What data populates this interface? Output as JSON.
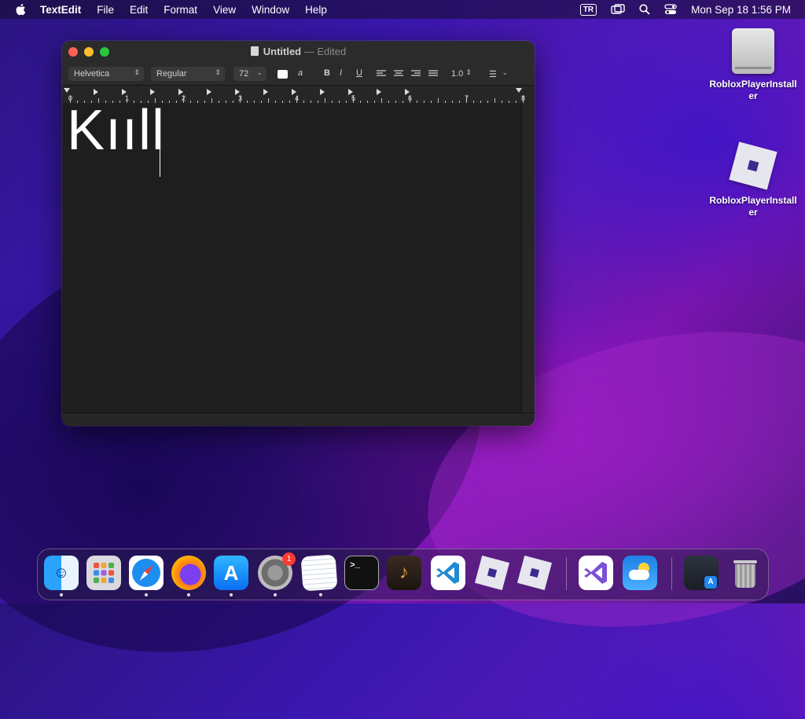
{
  "menubar": {
    "app_name": "TextEdit",
    "items": [
      "File",
      "Edit",
      "Format",
      "View",
      "Window",
      "Help"
    ],
    "input_source": "TR",
    "clock": "Mon Sep 18  1:56 PM"
  },
  "window": {
    "title": "Untitled",
    "separator": "—",
    "status": "Edited",
    "toolbar": {
      "font_family": "Helvetica",
      "font_style": "Regular",
      "font_size": "72",
      "bold": "B",
      "italic": "I",
      "underline": "U",
      "line_spacing": "1.0"
    },
    "ruler_numbers": [
      "0",
      "1",
      "2",
      "3",
      "4",
      "5",
      "6",
      "7",
      "8"
    ],
    "document_text": "Kııll"
  },
  "desktop": {
    "icons": [
      {
        "label": "RobloxPlayerInstaller",
        "kind": "disk-image"
      },
      {
        "label": "RobloxPlayerInstaller",
        "kind": "roblox-app"
      }
    ]
  },
  "dock": {
    "apps": [
      "Finder",
      "Launchpad",
      "Safari",
      "Firefox",
      "App Store",
      "System Settings",
      "TextEdit",
      "Terminal",
      "GarageBand",
      "Visual Studio Code",
      "Roblox",
      "Roblox Studio",
      "Visual Studio",
      "Weather",
      "Downloads",
      "Trash"
    ],
    "settings_badge": "1"
  },
  "colors": {
    "close": "#ff5f57",
    "minimize": "#febc2e",
    "zoom": "#28c840",
    "badge": "#ff3b30"
  }
}
